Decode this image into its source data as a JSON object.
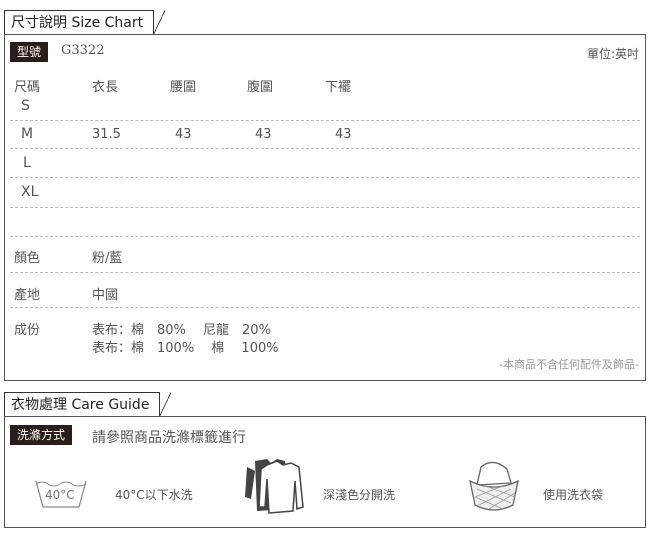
{
  "size_chart": {
    "tab_label": "尺寸說明 Size Chart",
    "model_tag": "型號",
    "model_no": "G3322",
    "unit": "單位:英吋",
    "headers": [
      "尺碼",
      "衣長",
      "腰圍",
      "腹圍",
      "下襬"
    ],
    "rows": [
      {
        "size": "S",
        "values": [
          "",
          "",
          "",
          ""
        ]
      },
      {
        "size": "M",
        "values": [
          "31.5",
          "43",
          "43",
          "43"
        ]
      },
      {
        "size": "L",
        "values": [
          "",
          "",
          "",
          ""
        ]
      },
      {
        "size": "XL",
        "values": [
          "",
          "",
          "",
          ""
        ]
      }
    ],
    "color_label": "顏色",
    "color_value": "粉/藍",
    "origin_label": "產地",
    "origin_value": "中國",
    "material_label": "成份",
    "material_line1": "表布：棉　80%　 尼龍　20%",
    "material_line2": "表布：棉　100%　 棉　 100%",
    "note": "-本商品不含任何配件及飾品-"
  },
  "care": {
    "tab_label": "衣物處理 Care Guide",
    "wash_tag": "洗滌方式",
    "wash_text": "請參照商品洗滌標籤進行",
    "icon1_text": "40°C",
    "item1": "40°C以下水洗",
    "item2": "深淺色分開洗",
    "item3": "使用洗衣袋"
  }
}
